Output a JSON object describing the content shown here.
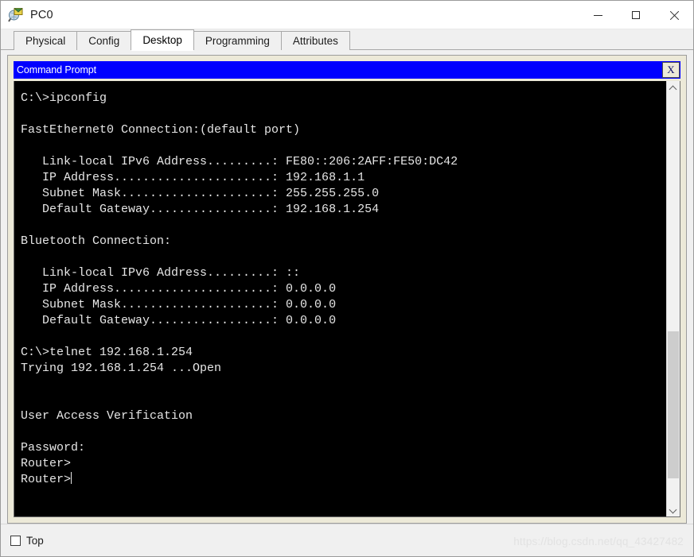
{
  "window": {
    "title": "PC0",
    "icon": "pc-device-icon",
    "controls": {
      "minimize": "minimize-button",
      "maximize": "maximize-button",
      "close": "close-button"
    }
  },
  "tabs": [
    {
      "label": "Physical",
      "active": false
    },
    {
      "label": "Config",
      "active": false
    },
    {
      "label": "Desktop",
      "active": true
    },
    {
      "label": "Programming",
      "active": false
    },
    {
      "label": "Attributes",
      "active": false
    }
  ],
  "command_prompt": {
    "title": "Command Prompt",
    "close_label": "X",
    "title_bg": "#0000ff",
    "terminal_bg": "#000000",
    "terminal_fg": "#e6e6e6",
    "lines": [
      "C:\\>ipconfig",
      "",
      "FastEthernet0 Connection:(default port)",
      "",
      "   Link-local IPv6 Address.........: FE80::206:2AFF:FE50:DC42",
      "   IP Address......................: 192.168.1.1",
      "   Subnet Mask.....................: 255.255.255.0",
      "   Default Gateway.................: 192.168.1.254",
      "",
      "Bluetooth Connection:",
      "",
      "   Link-local IPv6 Address.........: ::",
      "   IP Address......................: 0.0.0.0",
      "   Subnet Mask.....................: 0.0.0.0",
      "   Default Gateway.................: 0.0.0.0",
      "",
      "C:\\>telnet 192.168.1.254",
      "Trying 192.168.1.254 ...Open",
      "",
      "",
      "User Access Verification",
      "",
      "Password:",
      "Router>"
    ],
    "prompt_line": "Router>",
    "scrollbar": {
      "up_arrow": "scroll-up-arrow",
      "down_arrow": "scroll-down-arrow",
      "thumb_top_percent": 58,
      "thumb_height_percent": 36
    }
  },
  "statusbar": {
    "top_checkbox_label": "Top",
    "top_checkbox_checked": false
  },
  "watermark": {
    "text": "https://blog.csdn.net/qq_43427482"
  }
}
